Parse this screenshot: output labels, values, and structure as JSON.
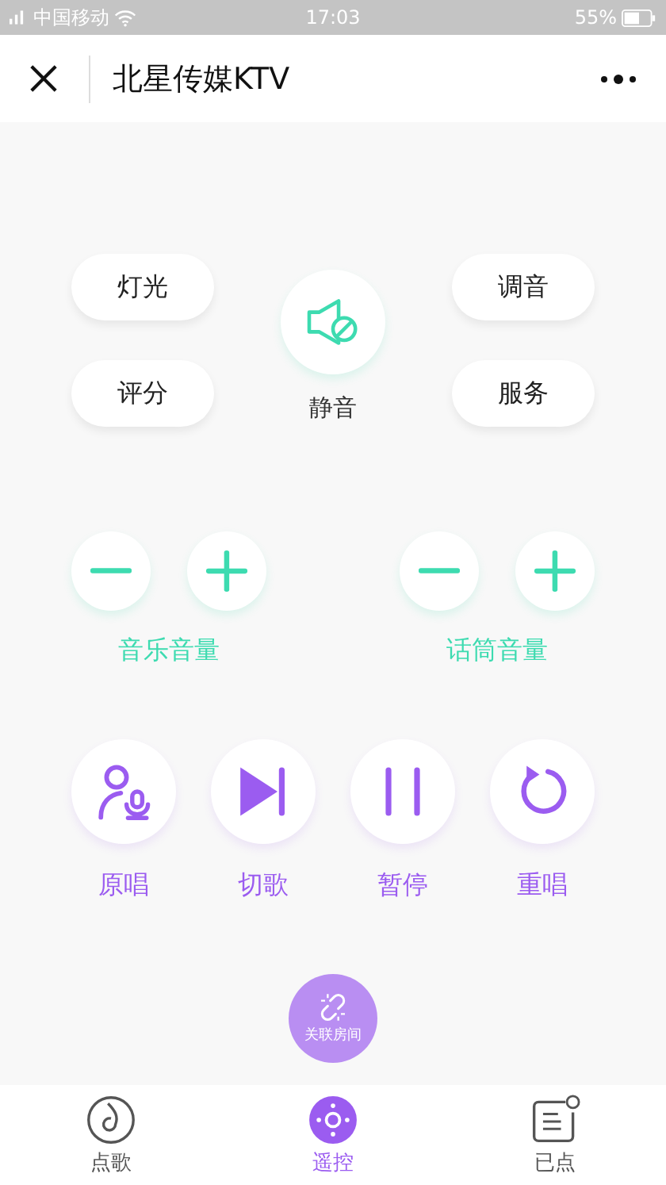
{
  "status_bar": {
    "carrier": "中国移动",
    "time": "17:03",
    "battery": "55%"
  },
  "header": {
    "title": "北星传媒KTV"
  },
  "left_buttons": [
    {
      "label": "灯光"
    },
    {
      "label": "评分"
    }
  ],
  "mute": {
    "label": "静音"
  },
  "right_buttons": [
    {
      "label": "调音"
    },
    {
      "label": "服务"
    }
  ],
  "volume_groups": [
    {
      "label": "音乐音量"
    },
    {
      "label": "话筒音量"
    }
  ],
  "playback_controls": [
    {
      "kind": "vocal",
      "label": "原唱"
    },
    {
      "kind": "next",
      "label": "切歌"
    },
    {
      "kind": "pause",
      "label": "暂停"
    },
    {
      "kind": "replay",
      "label": "重唱"
    }
  ],
  "link_room": {
    "label": "关联房间"
  },
  "tabs": [
    {
      "kind": "songs",
      "label": "点歌",
      "selected": false
    },
    {
      "kind": "remote",
      "label": "遥控",
      "selected": true
    },
    {
      "kind": "queue",
      "label": "已点",
      "selected": false
    }
  ]
}
